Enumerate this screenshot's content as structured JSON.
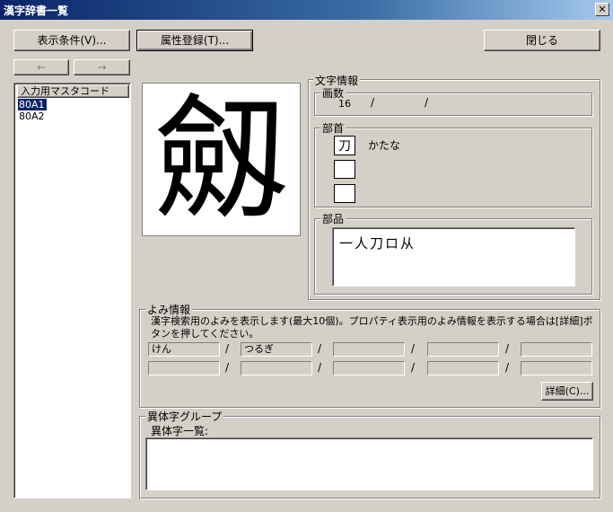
{
  "window": {
    "title": "漢字辞書一覧",
    "close_glyph": "✕"
  },
  "toolbar": {
    "display_conditions": "表示条件(V)...",
    "attribute_register": "属性登録(T)...",
    "close": "閉じる",
    "prev_arrow": "←",
    "next_arrow": "→"
  },
  "list": {
    "header": "入力用マスタコード",
    "items": [
      "80A1",
      "80A2"
    ]
  },
  "preview": {
    "glyph": "劔"
  },
  "char_info": {
    "title": "文字情報",
    "strokes": {
      "title": "画数",
      "value": "16",
      "sep1": "/",
      "sep2": "/"
    },
    "radical": {
      "title": "部首",
      "entries": [
        {
          "glyph": "刀",
          "reading": "かたな"
        },
        {
          "glyph": "",
          "reading": ""
        },
        {
          "glyph": "",
          "reading": ""
        }
      ]
    },
    "parts": {
      "title": "部品",
      "value": "一人刀ロ从"
    }
  },
  "reading": {
    "title": "よみ情報",
    "description": "漢字検索用のよみを表示します(最大10個)。プロパティ表示用のよみ情報を表示する場合は[詳細]ボタンを押してください。",
    "row1": [
      "けん",
      "つるぎ",
      "",
      "",
      ""
    ],
    "row2": [
      "",
      "",
      "",
      "",
      ""
    ],
    "sep": "/",
    "detail_button": "詳細(C)..."
  },
  "variant": {
    "title": "異体字グループ",
    "list_label": "異体字一覧:"
  }
}
